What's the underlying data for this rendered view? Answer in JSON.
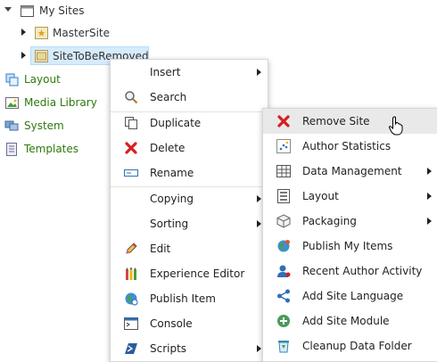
{
  "tree": {
    "root_label": "My Sites",
    "items": [
      {
        "label": "MasterSite"
      },
      {
        "label": "SiteToBeRemoved"
      }
    ],
    "other": [
      {
        "label": "Layout"
      },
      {
        "label": "Media Library"
      },
      {
        "label": "System"
      },
      {
        "label": "Templates"
      }
    ]
  },
  "context_menu": {
    "items": [
      {
        "label": "Insert",
        "icon": "none",
        "submenu": true
      },
      {
        "label": "Search",
        "icon": "magnifier-icon"
      },
      {
        "label": "Duplicate",
        "icon": "copy-icon"
      },
      {
        "label": "Delete",
        "icon": "red-x-icon"
      },
      {
        "label": "Rename",
        "icon": "rename-icon"
      },
      {
        "label": "Copying",
        "icon": "none",
        "submenu": true
      },
      {
        "label": "Sorting",
        "icon": "none",
        "submenu": true
      },
      {
        "label": "Edit",
        "icon": "pencil-icon"
      },
      {
        "label": "Experience Editor",
        "icon": "crayons-icon"
      },
      {
        "label": "Publish Item",
        "icon": "globe-icon"
      },
      {
        "label": "Console",
        "icon": "console-icon"
      },
      {
        "label": "Scripts",
        "icon": "powershell-icon",
        "submenu": true
      }
    ]
  },
  "submenu": {
    "items": [
      {
        "label": "Remove Site",
        "icon": "red-x-icon",
        "highlighted": true
      },
      {
        "label": "Author Statistics",
        "icon": "chart-icon"
      },
      {
        "label": "Data Management",
        "icon": "grid-icon",
        "submenu": true
      },
      {
        "label": "Layout",
        "icon": "layout-icon",
        "submenu": true
      },
      {
        "label": "Packaging",
        "icon": "package-icon",
        "submenu": true
      },
      {
        "label": "Publish My Items",
        "icon": "globe-icon"
      },
      {
        "label": "Recent Author Activity",
        "icon": "user-icon"
      },
      {
        "label": "Add Site Language",
        "icon": "share-icon"
      },
      {
        "label": "Add Site Module",
        "icon": "plus-circle-icon"
      },
      {
        "label": "Cleanup Data Folder",
        "icon": "recycle-bin-icon"
      }
    ]
  },
  "colors": {
    "tree_green": "#2b7a0b",
    "selection": "#d6ebfb",
    "menu_highlight": "#e9e9e9",
    "delete_red": "#d42020"
  }
}
